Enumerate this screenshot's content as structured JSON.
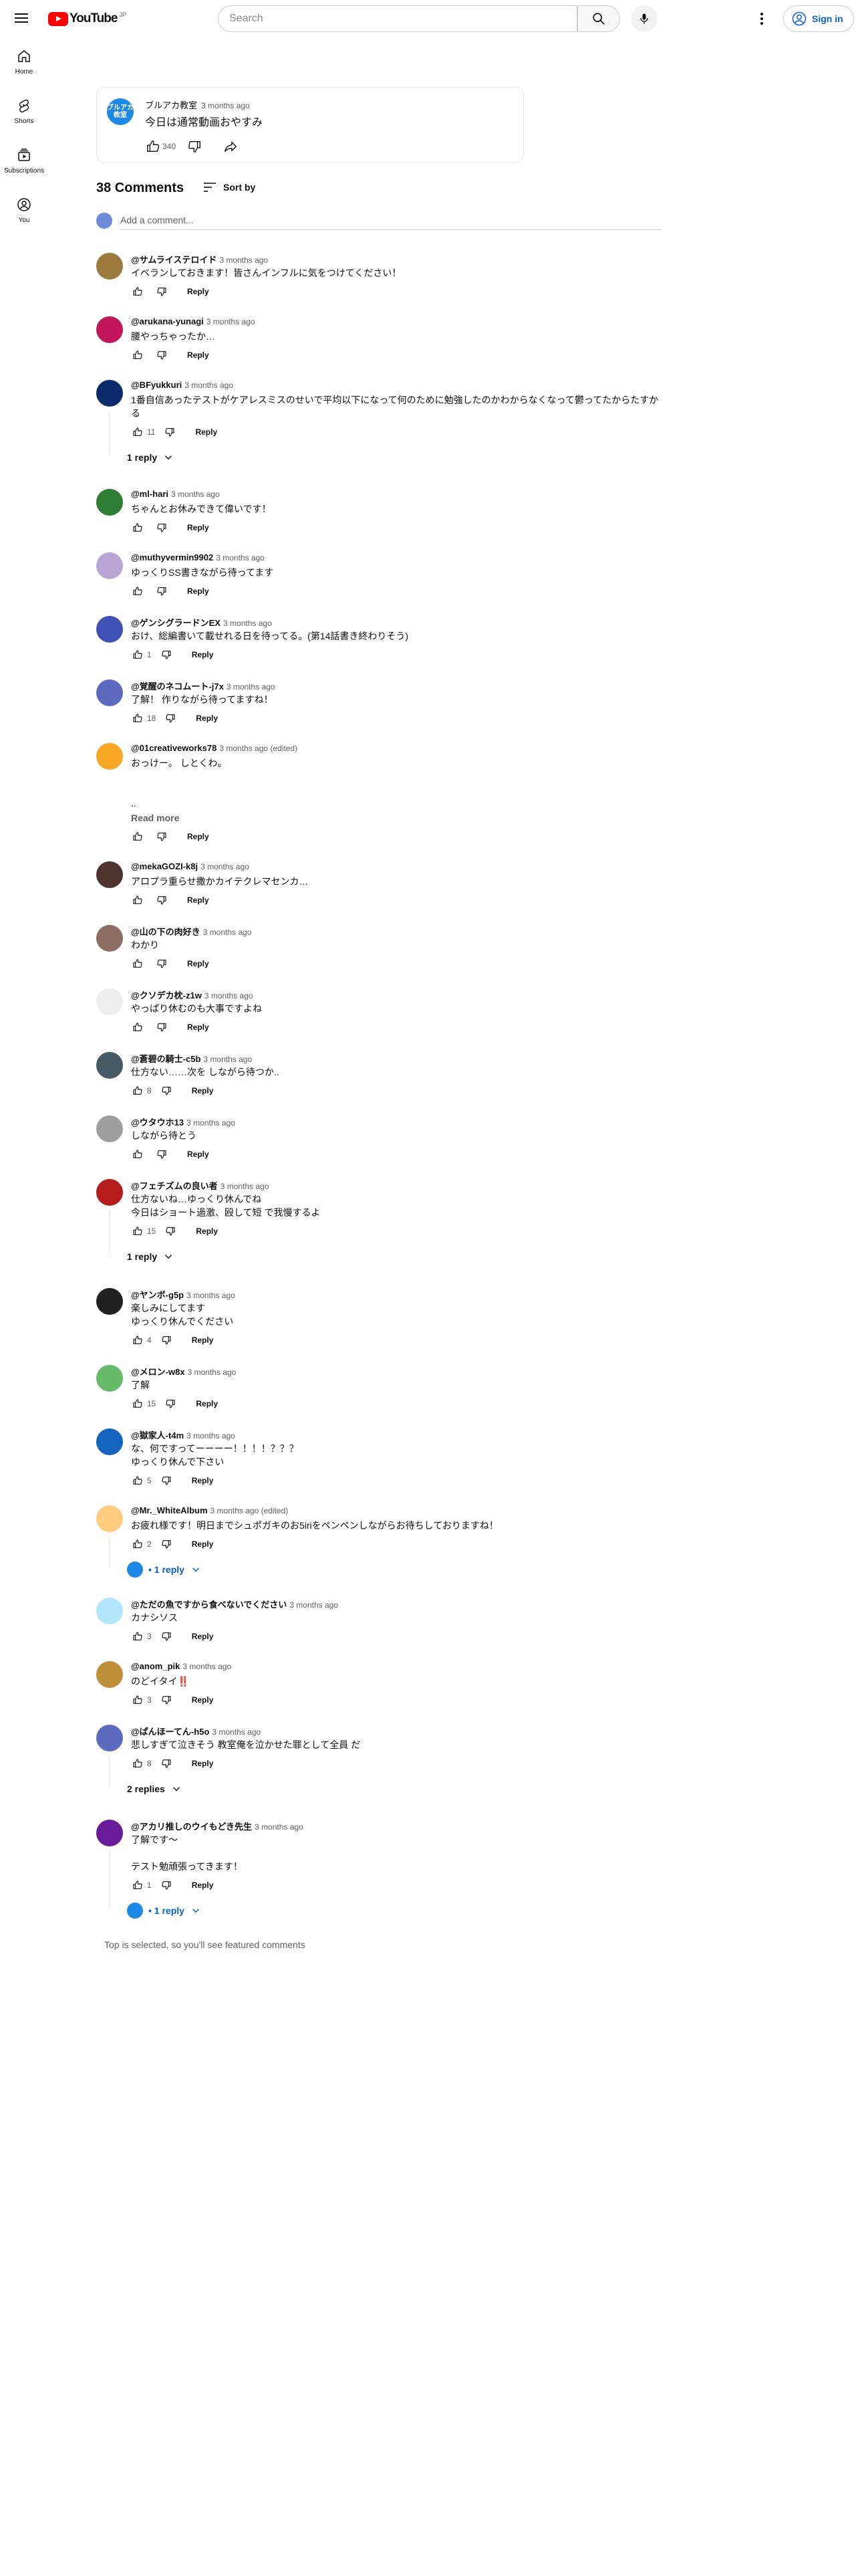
{
  "masthead": {
    "logo_text": "YouTube",
    "logo_sup": "JP",
    "search_placeholder": "Search",
    "signin_label": "Sign in"
  },
  "guide": {
    "items": [
      {
        "label": "Home",
        "icon": "home-icon"
      },
      {
        "label": "Shorts",
        "icon": "shorts-icon"
      },
      {
        "label": "Subscriptions",
        "icon": "subscriptions-icon"
      },
      {
        "label": "You",
        "icon": "you-icon"
      }
    ]
  },
  "post": {
    "avatar_text_1": "ブルアカ",
    "avatar_text_2": "教室",
    "author": "ブルアカ教室",
    "time": "3 months ago",
    "text": "今日は通常動画おやすみ",
    "likes": "340"
  },
  "comments_header": {
    "count_label": "38 Comments",
    "sort_label": "Sort by",
    "add_placeholder": "Add a comment..."
  },
  "reply_label": "Reply",
  "comments": [
    {
      "author": "@サムライステロイド",
      "time": "3 months ago",
      "lines": [
        "イベランしておきます！皆さんインフルに気をつけてください！"
      ],
      "likes": ""
    },
    {
      "author": "@arukana-yunagi",
      "time": "3 months ago",
      "lines": [
        "腰やっちゃったか…"
      ],
      "likes": ""
    },
    {
      "author": "@BFyukkuri",
      "time": "3 months ago",
      "lines": [
        "1番自信あったテストがケアレスミスのせいで平均以下になって何のために勉強したのかわからなくなって鬱ってたからたすか",
        "る"
      ],
      "likes": "11",
      "replies": "1 reply"
    },
    {
      "author": "@ml-hari",
      "time": "3 months ago",
      "lines": [
        "ちゃんとお休みできて偉いです！"
      ],
      "likes": ""
    },
    {
      "author": "@muthyvermin9902",
      "time": "3 months ago",
      "lines": [
        "ゆっくりSS書きながら待ってます"
      ],
      "likes": ""
    },
    {
      "author": "@ゲンシグラードンEX",
      "time": "3 months ago",
      "lines": [
        "おけ、総編書いて載せれる日を待ってる。(第14話書き終わりそう)"
      ],
      "likes": "1"
    },
    {
      "author": "@覚醒のネコムート-j7x",
      "time": "3 months ago",
      "lines": [
        "了解！ 作りながら待ってますね！"
      ],
      "likes": "18"
    },
    {
      "author": "@01creativeworks78",
      "time": "3 months ago (edited)",
      "lines": [
        "おっけー。 しとくわ。",
        "",
        "",
        ".."
      ],
      "readmore": "Read more",
      "likes": ""
    },
    {
      "author": "@mekaGOZI-k8j",
      "time": "3 months ago",
      "lines": [
        "アロプラ重らせ撒かカイテクレマセンカ…"
      ],
      "likes": ""
    },
    {
      "author": "@山の下の肉好き",
      "time": "3 months ago",
      "lines": [
        "わかり"
      ],
      "likes": ""
    },
    {
      "author": "@クソデカ枕-z1w",
      "time": "3 months ago",
      "lines": [
        "やっぱり休むのも大事ですよね"
      ],
      "likes": ""
    },
    {
      "author": "@蒼碧の騎士-c5b",
      "time": "3 months ago",
      "lines": [
        "仕方ない……次を しながら待つか.."
      ],
      "likes": "8"
    },
    {
      "author": "@ウタウホ13",
      "time": "3 months ago",
      "lines": [
        "しながら待とう"
      ],
      "likes": ""
    },
    {
      "author": "@フェチズムの良い者",
      "time": "3 months ago",
      "lines": [
        "仕方ないね…ゆっくり休んでね",
        "今日はショート過激、殴して短 で我慢するよ"
      ],
      "likes": "15",
      "replies": "1 reply"
    },
    {
      "author": "@ヤンボ-g5p",
      "time": "3 months ago",
      "lines": [
        "楽しみにしてます",
        "ゆっくり休んでください"
      ],
      "likes": "4"
    },
    {
      "author": "@メロン-w8x",
      "time": "3 months ago",
      "lines": [
        "了解"
      ],
      "likes": "15"
    },
    {
      "author": "@獄家人-t4m",
      "time": "3 months ago",
      "lines": [
        "な、何ですってーーーー！！！！？？？",
        "ゆっくり休んで下さい"
      ],
      "likes": "5"
    },
    {
      "author": "@Mr._WhiteAlbum",
      "time": "3 months ago (edited)",
      "lines": [
        "お疲れ様です！明日までシュポガキのお5iriをペンペンしながらお待ちしておりますね！"
      ],
      "likes": "2",
      "replies": "• 1 reply",
      "replies_avatar": true
    },
    {
      "author": "@ただの魚ですから食べないでください",
      "time": "3 months ago",
      "lines": [
        "カナシソス"
      ],
      "likes": "3"
    },
    {
      "author": "@anom_pik",
      "time": "3 months ago",
      "lines": [
        "のどイタイ‼️"
      ],
      "likes": "3"
    },
    {
      "author": "@ぱんほーてん-h5o",
      "time": "3 months ago",
      "lines": [
        "悲しすぎて泣きそう 教室俺を泣かせた罪として全員 だ"
      ],
      "likes": "8",
      "replies": "2 replies",
      "replies_dark": true
    },
    {
      "author": "@アカリ推しのウイもどき先生",
      "time": "3 months ago",
      "lines": [
        "了解です〜",
        "",
        "テスト勉頑張ってきます！"
      ],
      "likes": "1",
      "replies": "• 1 reply",
      "replies_avatar": true
    }
  ],
  "footer_note": "Top is selected, so you'll see featured comments"
}
